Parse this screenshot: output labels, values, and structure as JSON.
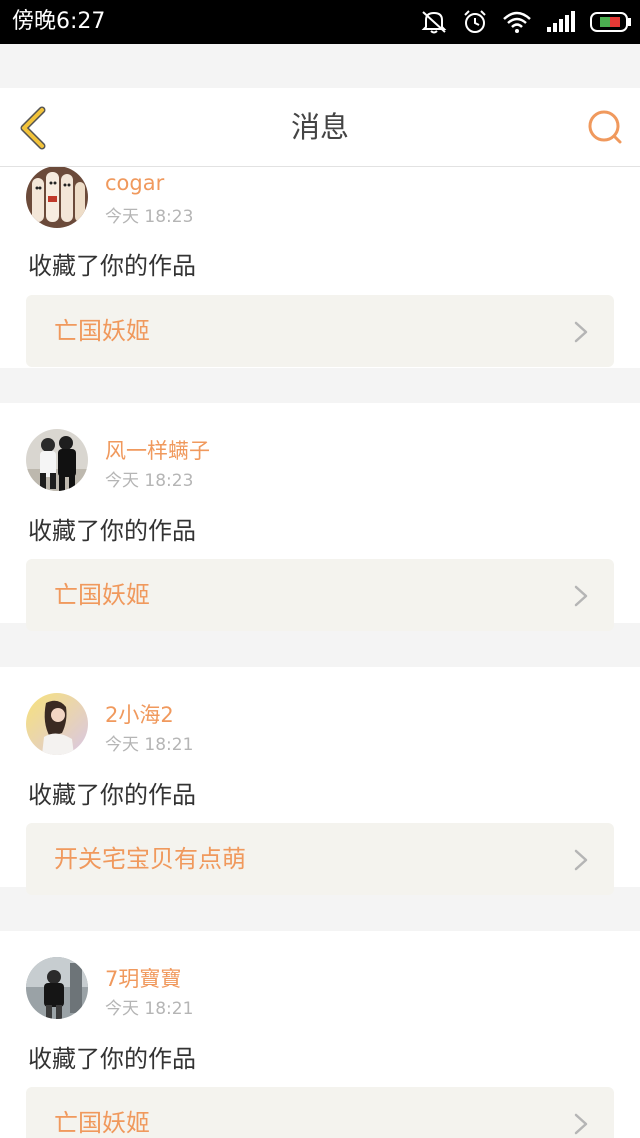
{
  "status_bar": {
    "time": "傍晚6:27",
    "icons": [
      "mute-icon",
      "alarm-icon",
      "wifi-icon",
      "signal-icon",
      "battery-icon"
    ]
  },
  "header": {
    "title": "消息",
    "back_icon": "back-chevron-icon",
    "search_icon": "search-icon"
  },
  "colors": {
    "accent": "#f0995d",
    "back_icon": "#f2c33a",
    "card_bg": "#ffffff",
    "page_bg": "#f4f4f4",
    "work_bg": "#f4f3ee"
  },
  "notifications": [
    {
      "username": "cogar",
      "time": "今天 18:23",
      "action": "收藏了你的作品",
      "work_title": "亡国妖姬"
    },
    {
      "username": "风一样螨子",
      "time": "今天 18:23",
      "action": "收藏了你的作品",
      "work_title": "亡国妖姬"
    },
    {
      "username": "2小海2",
      "time": "今天 18:21",
      "action": "收藏了你的作品",
      "work_title": "开关宅宝贝有点萌"
    },
    {
      "username": "7玥寶寶",
      "time": "今天 18:21",
      "action": "收藏了你的作品",
      "work_title": "亡国妖姬"
    }
  ]
}
